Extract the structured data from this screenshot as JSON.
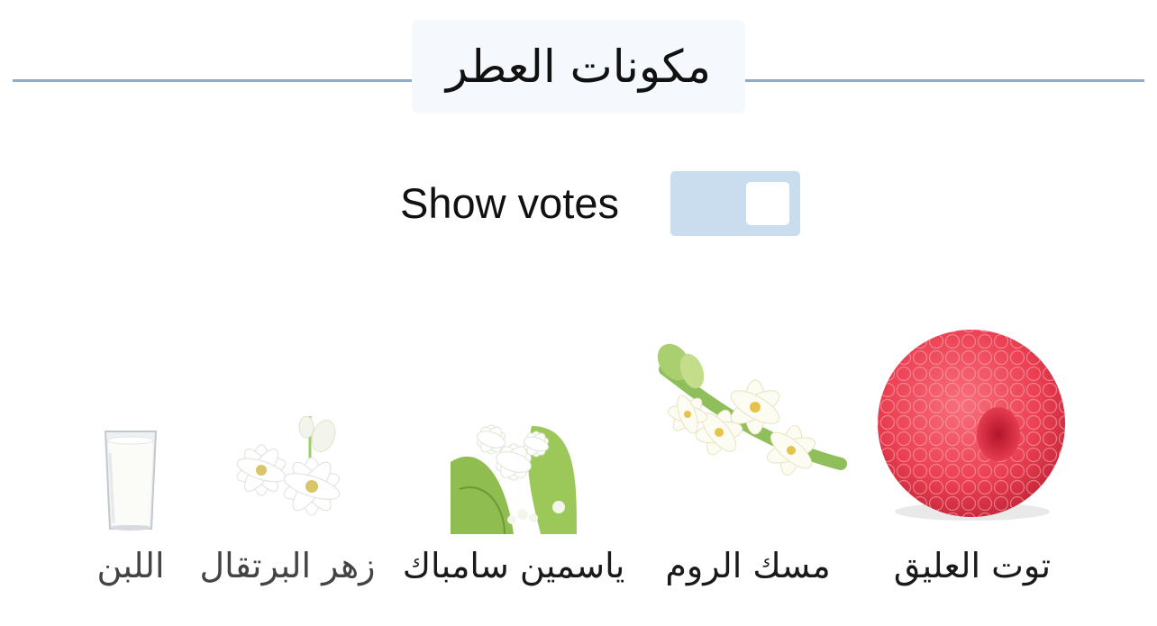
{
  "section": {
    "title": "مكونات العطر"
  },
  "votes_toggle": {
    "label": "Show votes",
    "enabled": false
  },
  "ingredients": [
    {
      "name": "توت العليق",
      "icon": "raspberry-icon"
    },
    {
      "name": "مسك الروم",
      "icon": "tuberose-icon"
    },
    {
      "name": "ياسمين سامباك",
      "icon": "sambac-jasmine-icon"
    },
    {
      "name": "زهر البرتقال",
      "icon": "orange-blossom-icon"
    },
    {
      "name": "اللبن",
      "icon": "milk-glass-icon"
    }
  ],
  "colors": {
    "divider": "#8eaacd",
    "title_bg": "#f5f9fd",
    "toggle_bg": "#c9ddef",
    "raspberry": "#ef4a5c"
  }
}
